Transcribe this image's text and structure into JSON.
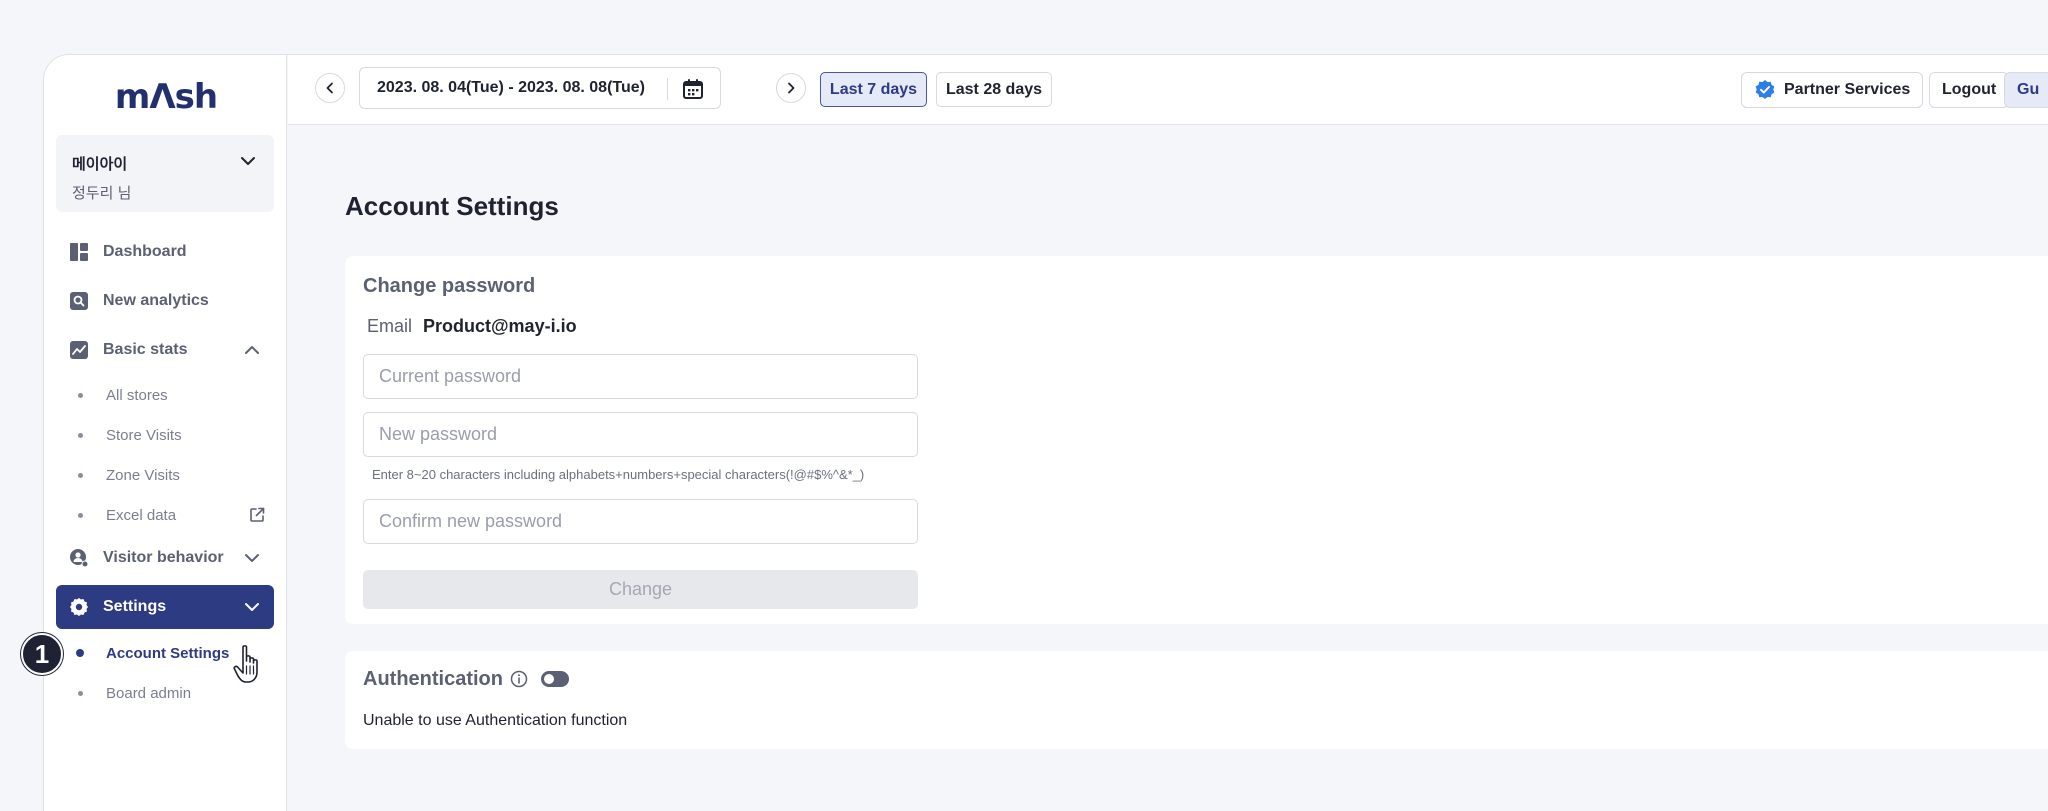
{
  "sidebar": {
    "logo": "mΛsh",
    "account": {
      "name": "메이아이",
      "user": "정두리 님"
    },
    "nav": {
      "dashboard": "Dashboard",
      "new_analytics": "New analytics",
      "basic_stats": "Basic stats",
      "visitor_behavior": "Visitor behavior",
      "settings": "Settings"
    },
    "basic_stats_items": {
      "all_stores": "All stores",
      "store_visits": "Store Visits",
      "zone_visits": "Zone Visits",
      "excel_data": "Excel data"
    },
    "settings_items": {
      "account_settings": "Account Settings",
      "board_admin": "Board admin"
    }
  },
  "topbar": {
    "date_range": "2023. 08. 04(Tue) - 2023. 08. 08(Tue)",
    "last_7_days": "Last 7 days",
    "last_28_days": "Last 28 days",
    "partner_services": "Partner Services",
    "logout": "Logout",
    "guide_partial": "Gu"
  },
  "main": {
    "title": "Account Settings",
    "change_password": {
      "title": "Change password",
      "email_label": "Email",
      "email_value": "Product@may-i.io",
      "current_placeholder": "Current password",
      "new_placeholder": "New password",
      "hint": "Enter 8~20 characters including alphabets+numbers+special characters(!@#$%^&*_)",
      "confirm_placeholder": "Confirm new password",
      "change_button": "Change"
    },
    "authentication": {
      "title": "Authentication",
      "toggle_on": false,
      "status_text": "Unable to use Authentication function"
    }
  },
  "overlay": {
    "step_number": "1"
  },
  "colors": {
    "primary": "#2d3b82",
    "logo": "#23306e",
    "verified": "#2f7ee8"
  }
}
